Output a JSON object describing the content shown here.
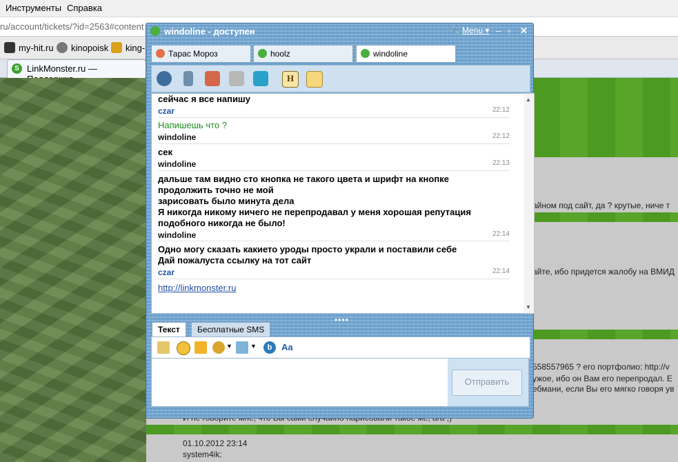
{
  "browser": {
    "menu": [
      "Инструменты",
      "Справка"
    ],
    "url": "ru/account/tickets/?id=2563#content",
    "bookmarks": [
      "my-hit.ru",
      "kinopoisk",
      "king-"
    ],
    "tab_title": "LinkMonster.ru — Поддержка"
  },
  "background_text": [
    "айном под сайт, да ? крутые, ниче т",
    "айте, ибо придется жалобу на ВМИД",
    "558557965 ? его портфолио: http://v",
    "ужое, ибо он Вам его перепродал. E",
    "ебмани, если Вы его мягко говоря ув",
    "И не говорите мне, что Вы сами случайно нарисовали такое же, ага ;)",
    "01.10.2012 23:14",
    "system4ik:"
  ],
  "icq": {
    "title": "windoline - доступен",
    "menu_label": "Menu",
    "tabs": [
      {
        "name": "Тарас Мороз"
      },
      {
        "name": "hoolz"
      },
      {
        "name": "windoline"
      }
    ],
    "messages": [
      {
        "text": [
          "сейчас я все напишу"
        ],
        "author": "czar",
        "time": "22:12",
        "style": "bold"
      },
      {
        "text": [
          "Напишешь что ?"
        ],
        "author": "windoline",
        "time": "22:12",
        "style": "green"
      },
      {
        "text": [
          "сек"
        ],
        "author": "windoline",
        "time": "22:13",
        "style": "bold"
      },
      {
        "text": [
          "дальше там видно сто кнопка не такого цвета и шрифт на кнопке",
          "продолжить точно не мой",
          "зарисовать было минута дела",
          "Я никогда никому ничего не перепродавал у меня хорошая репутация",
          "подобного никогда не было!"
        ],
        "author": "windoline",
        "time": "22:14",
        "style": "bold"
      },
      {
        "text": [
          "Одно могу сказать какието уроды просто украли и поставили себе",
          "Дай пожалуста ссылку на тот сайт"
        ],
        "author": "czar",
        "time": "22:14",
        "style": "bold"
      }
    ],
    "link": "http://linkmonster.ru",
    "input_tabs": [
      "Текст",
      "Бесплатные SMS"
    ],
    "send_label": "Отправить",
    "colors": {
      "czar": "#1f55a8",
      "windoline": "#111111",
      "green_text": "#1f8d1f"
    }
  }
}
